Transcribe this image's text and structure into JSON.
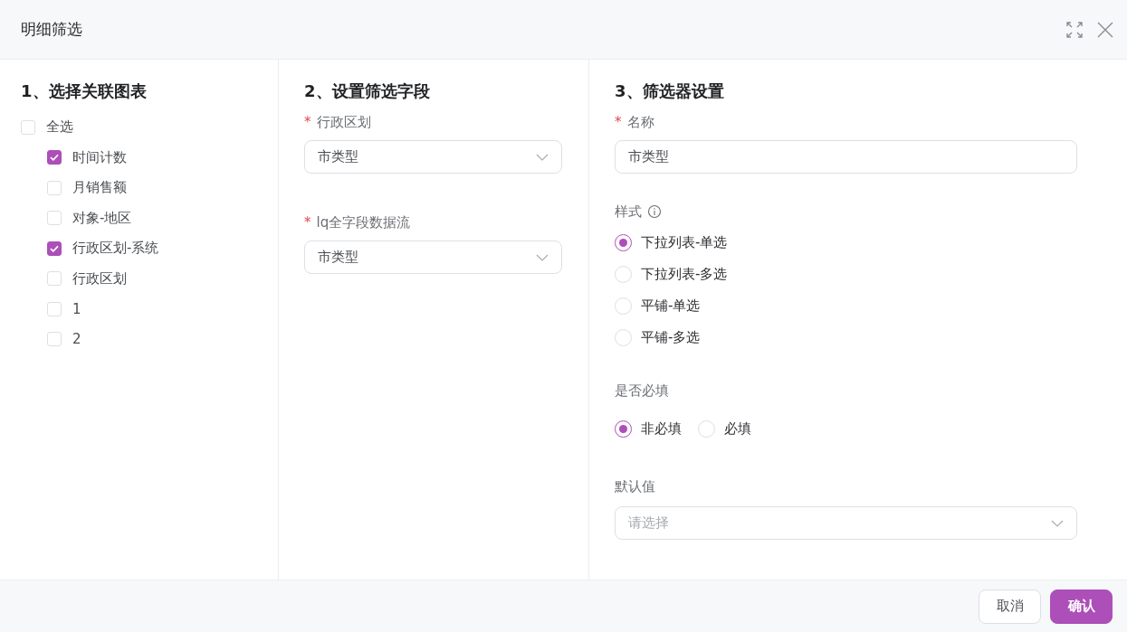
{
  "dialog": {
    "title": "明细筛选"
  },
  "chart_panel": {
    "heading": "1、选择关联图表",
    "select_all": {
      "label": "全选",
      "checked": false
    },
    "charts": [
      {
        "label": "时间计数",
        "checked": true
      },
      {
        "label": "月销售额",
        "checked": false
      },
      {
        "label": "对象-地区",
        "checked": false
      },
      {
        "label": "行政区划-系统",
        "checked": true
      },
      {
        "label": "行政区划",
        "checked": false
      },
      {
        "label": "1",
        "checked": false
      },
      {
        "label": "2",
        "checked": false
      }
    ]
  },
  "field_panel": {
    "heading": "2、设置筛选字段",
    "fields": [
      {
        "required_mark": "*",
        "label": "行政区划",
        "value": "市类型"
      },
      {
        "required_mark": "*",
        "label": "lq全字段数据流",
        "value": "市类型"
      }
    ]
  },
  "filter_panel": {
    "heading": "3、筛选器设置",
    "name": {
      "required_mark": "*",
      "label": "名称",
      "value": "市类型"
    },
    "style": {
      "label": "样式",
      "options": [
        {
          "label": "下拉列表-单选",
          "selected": true
        },
        {
          "label": "下拉列表-多选",
          "selected": false
        },
        {
          "label": "平铺-单选",
          "selected": false
        },
        {
          "label": "平铺-多选",
          "selected": false
        }
      ]
    },
    "required_setting": {
      "label": "是否必填",
      "options": [
        {
          "label": "非必填",
          "selected": true
        },
        {
          "label": "必填",
          "selected": false
        }
      ]
    },
    "default_value": {
      "label": "默认值",
      "placeholder": "请选择"
    }
  },
  "buttons": [
    {
      "label": "取消",
      "kind": "secondary"
    },
    {
      "label": "确认",
      "kind": "primary"
    }
  ]
}
